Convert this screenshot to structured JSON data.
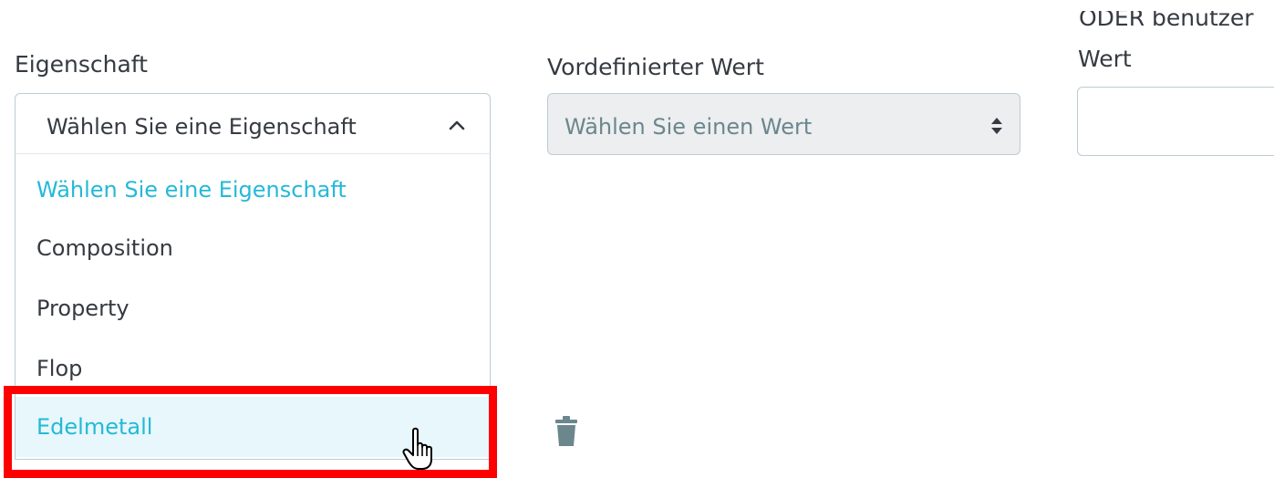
{
  "form": {
    "property_label": "Eigenschaft",
    "predefined_label": "Vordefinierter Wert",
    "custom_label_line1": "ODER benutzer",
    "custom_label_line2": "Wert"
  },
  "property_select": {
    "value": "Wählen Sie eine Eigenschaft",
    "icon": "chevron-up-icon",
    "options": [
      "Wählen Sie eine Eigenschaft",
      "Composition",
      "Property",
      "Flop",
      "Edelmetall"
    ],
    "active_index": 0,
    "hover_index": 4
  },
  "predefined_select": {
    "value": "Wählen Sie einen Wert",
    "disabled": true,
    "icon": "sort-updown-icon"
  },
  "custom_value_input": {
    "value": ""
  },
  "actions": {
    "delete_icon": "trash-icon"
  },
  "colors": {
    "accent": "#25b9d7",
    "hover_bg": "#e7f7fb",
    "highlight": "#ff0000",
    "border": "#bbcdd2",
    "disabled_bg": "#eceeef"
  }
}
